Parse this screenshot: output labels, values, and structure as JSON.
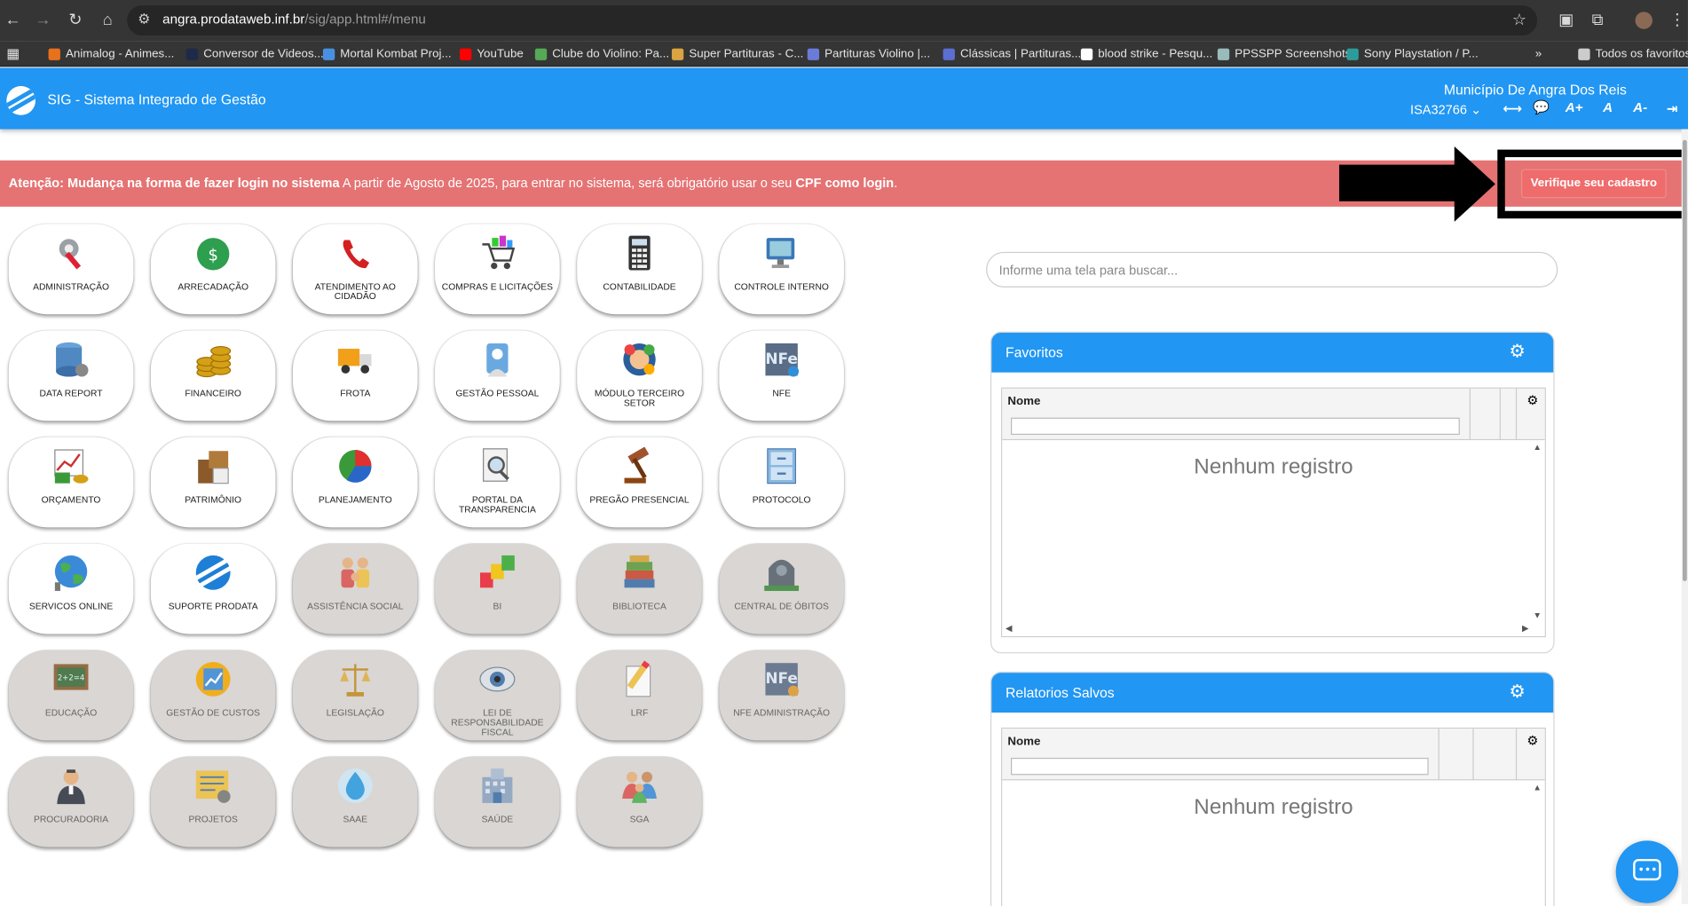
{
  "browser": {
    "url_host": "angra.prodataweb.inf.br",
    "url_path": "/sig/app.html#/menu"
  },
  "bookmarks": [
    {
      "label": "Animalog - Animes...",
      "color": "#e8711c"
    },
    {
      "label": "Conversor de Videos...",
      "color": "#1e2a4a"
    },
    {
      "label": "Mortal Kombat Proj...",
      "color": "#4a90e2"
    },
    {
      "label": "YouTube",
      "color": "#ff0000"
    },
    {
      "label": "Clube do Violino: Pa...",
      "color": "#55aa55"
    },
    {
      "label": "Super Partituras - C...",
      "color": "#d9a441"
    },
    {
      "label": "Partituras Violino |...",
      "color": "#6a7bd8"
    },
    {
      "label": "Clássicas | Partituras...",
      "color": "#5a6fd0"
    },
    {
      "label": "blood strike - Pesqu...",
      "color": "#ffffff"
    },
    {
      "label": "PPSSPP Screenshots",
      "color": "#9bb"
    },
    {
      "label": "Sony Playstation / P...",
      "color": "#2e9b9b"
    },
    {
      "label": "Todos os favoritos",
      "color": "#cccccc"
    }
  ],
  "app": {
    "title": "SIG - Sistema Integrado de Gestão",
    "municipality": "Município De Angra Dos Reis",
    "user": "ISA32766",
    "font_increase": "A+",
    "font_normal": "A",
    "font_decrease": "A-"
  },
  "alert": {
    "bold_lead": "Atenção: Mudança na forma de fazer login no sistema",
    "text": " A partir de Agosto de 2025, para entrar no sistema, será obrigatório usar o seu ",
    "bold_tail": "CPF como login",
    "end": ".",
    "button": "Verifique seu cadastro"
  },
  "modules": [
    {
      "label": "Administração",
      "icon": "tools-icon",
      "enabled": true
    },
    {
      "label": "Arrecadação",
      "icon": "money-bag-icon",
      "enabled": true
    },
    {
      "label": "Atendimento ao cidadão",
      "icon": "phone-icon",
      "enabled": true
    },
    {
      "label": "Compras e licitações",
      "icon": "cart-icon",
      "enabled": true
    },
    {
      "label": "Contabilidade",
      "icon": "calculator-icon",
      "enabled": true
    },
    {
      "label": "Controle interno",
      "icon": "monitor-icon",
      "enabled": true
    },
    {
      "label": "Data report",
      "icon": "database-icon",
      "enabled": true
    },
    {
      "label": "Financeiro",
      "icon": "coins-icon",
      "enabled": true
    },
    {
      "label": "Frota",
      "icon": "truck-icon",
      "enabled": true
    },
    {
      "label": "Gestão pessoal",
      "icon": "person-card-icon",
      "enabled": true
    },
    {
      "label": "Módulo terceiro setor",
      "icon": "people-circle-icon",
      "enabled": true
    },
    {
      "label": "NFE",
      "icon": "nfe-icon",
      "enabled": true
    },
    {
      "label": "Orçamento",
      "icon": "budget-chart-icon",
      "enabled": true
    },
    {
      "label": "Patrimônio",
      "icon": "boxes-icon",
      "enabled": true
    },
    {
      "label": "Planejamento",
      "icon": "pie-chart-icon",
      "enabled": true
    },
    {
      "label": "Portal da transparencia",
      "icon": "magnifier-doc-icon",
      "enabled": true
    },
    {
      "label": "Pregão presencial",
      "icon": "gavel-icon",
      "enabled": true
    },
    {
      "label": "Protocolo",
      "icon": "cabinet-icon",
      "enabled": true
    },
    {
      "label": "Servicos online",
      "icon": "globe-icon",
      "enabled": true
    },
    {
      "label": "Suporte prodata",
      "icon": "prodata-logo-icon",
      "enabled": true
    },
    {
      "label": "Assistência social",
      "icon": "family-icon",
      "enabled": false
    },
    {
      "label": "BI",
      "icon": "cubes-icon",
      "enabled": false
    },
    {
      "label": "Biblioteca",
      "icon": "books-icon",
      "enabled": false
    },
    {
      "label": "Central de óbitos",
      "icon": "tombstone-icon",
      "enabled": false
    },
    {
      "label": "Educação",
      "icon": "chalkboard-icon",
      "enabled": false
    },
    {
      "label": "Gestão de custos",
      "icon": "cost-chart-icon",
      "enabled": false
    },
    {
      "label": "Legislação",
      "icon": "scales-icon",
      "enabled": false
    },
    {
      "label": "Lei de responsabilidade fiscal",
      "icon": "eye-icon",
      "enabled": false
    },
    {
      "label": "LRF",
      "icon": "pencil-doc-icon",
      "enabled": false
    },
    {
      "label": "NFE administração",
      "icon": "nfe-admin-icon",
      "enabled": false
    },
    {
      "label": "Procuradoria",
      "icon": "lawyer-icon",
      "enabled": false
    },
    {
      "label": "Projetos",
      "icon": "blueprint-icon",
      "enabled": false
    },
    {
      "label": "SAAE",
      "icon": "water-drop-icon",
      "enabled": false
    },
    {
      "label": "Saúde",
      "icon": "hospital-icon",
      "enabled": false
    },
    {
      "label": "SGA",
      "icon": "group-icon",
      "enabled": false
    }
  ],
  "search": {
    "placeholder": "Informe uma tela para buscar..."
  },
  "favorites": {
    "title": "Favoritos",
    "column": "Nome",
    "empty": "Nenhum registro"
  },
  "reports": {
    "title": "Relatorios Salvos",
    "column": "Nome",
    "empty": "Nenhum registro"
  },
  "colors": {
    "primary": "#2196f3",
    "alert": "#e57373",
    "disabled_tile": "#d9d6d3"
  }
}
